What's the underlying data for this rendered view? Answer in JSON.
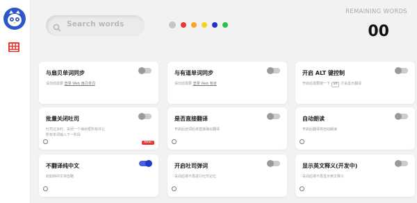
{
  "header": {
    "search_placeholder": "Search words",
    "remaining_label": "REMAINING WORDS",
    "remaining_count": "00",
    "colors": [
      {
        "name": "gray",
        "hex": "#c4c4c4",
        "selected": true
      },
      {
        "name": "red",
        "hex": "#e53935",
        "selected": false
      },
      {
        "name": "orange",
        "hex": "#f5a623",
        "selected": false
      },
      {
        "name": "yellow",
        "hex": "#f7d51d",
        "selected": false
      },
      {
        "name": "blue",
        "hex": "#2233cc",
        "selected": false
      },
      {
        "name": "green",
        "hex": "#2ec04f",
        "selected": false
      }
    ]
  },
  "sidebar": {
    "logo_icon": "owl-logo-icon",
    "items": [
      {
        "icon": "book-grid-icon",
        "color": "#e53935"
      }
    ]
  },
  "cards": [
    {
      "title": "与扇贝单词同步",
      "desc_pre": "请勿前需要",
      "desc_link": "登录 Web 扇贝单词",
      "desc_post": "",
      "toggle_on": false
    },
    {
      "title": "与有道单词同步",
      "desc_pre": "请勿前需要",
      "desc_link": "登录 Web 有道",
      "desc_post": "",
      "toggle_on": false
    },
    {
      "title": "开启 ALT 键控制",
      "desc_pre": "开启后需要按一下",
      "desc_kbd": "alt",
      "desc_post": "才会显示翻译",
      "toggle_on": false
    },
    {
      "title": "批量关闭吐司",
      "desc_pre": "吐司过多时，关闭一个弹出框所有并让",
      "desc_post2": "所有单词输入下一阶段",
      "toggle_on": false,
      "badge": "New!"
    },
    {
      "title": "是否直接翻译",
      "desc_pre": "开启后划词后将直接弹出翻译",
      "toggle_on": false
    },
    {
      "title": "自动朗读",
      "desc_pre": "开启后翻译将自动朗读",
      "toggle_on": false
    },
    {
      "title": "不翻译纯中文",
      "desc_pre": "划如纯中文将忽略",
      "toggle_on": true
    },
    {
      "title": "开启吐司弹词",
      "desc_pre": "关闭后将不再进行吐司记忆",
      "toggle_on": false
    },
    {
      "title": "显示英文释义(开发中)",
      "desc_pre": "关闭后将不再显示英文释义",
      "toggle_on": false
    }
  ]
}
